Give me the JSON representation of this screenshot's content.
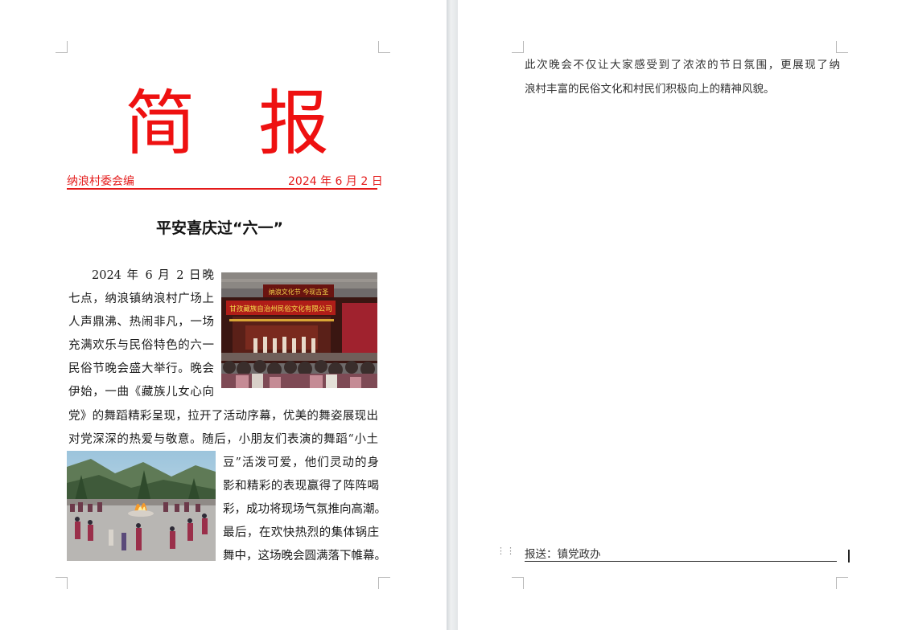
{
  "masthead": {
    "char1": "简",
    "char2": "报"
  },
  "meta": {
    "publisher": "纳浪村委会编",
    "date": "2024 年 6 月 2 日"
  },
  "headline": "平安喜庆过“六一”",
  "body_lines_top": [
    "2024 年 6 月 2 日晚",
    "七点，纳浪镇纳浪村广场上",
    "人声鼎沸、热闹非凡，一场",
    "充满欢乐与民俗特色的六一",
    "民俗节晚会盛大举行。晚会",
    "伊始，一曲《藏族儿女心向"
  ],
  "body_lines_full": [
    "党》的舞蹈精彩呈现，拉开了活动序幕，优美的舞姿展现出",
    "对党深深的热爱与敬意。随后，小朋友们表演的舞蹈“小土"
  ],
  "body_lines_bottom": [
    "豆”活泼可爱，他们灵动的身",
    "影和精彩的表现赢得了阵阵喝",
    "彩，成功将现场气氛推向高潮。",
    "最后，在欢快热烈的集体锅庄",
    "舞中，这场晚会圆满落下帷幕。"
  ],
  "photo_stage": {
    "top_banner": "纳浪文化节    今现古圣",
    "main_banner": "甘孜藏族自治州民俗文化有限公司"
  },
  "right_body_lines": [
    "此次晚会不仅让大家感受到了浓浓的节日氛围，更展现了纳",
    "浪村丰富的民俗文化和村民们积极向上的精神风貌。"
  ],
  "footer": "报送：镇党政办",
  "colors": {
    "accent_red": "#e41a1a",
    "masthead_red": "#ee1111"
  },
  "icons": {
    "handle": "drag-handle-icon"
  }
}
